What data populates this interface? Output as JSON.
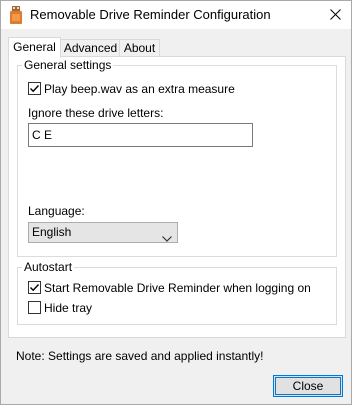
{
  "window": {
    "title": "Removable Drive Reminder Configuration"
  },
  "tabs": [
    {
      "label": "General",
      "active": true
    },
    {
      "label": "Advanced",
      "active": false
    },
    {
      "label": "About",
      "active": false
    }
  ],
  "general_settings": {
    "title": "General settings",
    "play_beep": {
      "label": "Play beep.wav as an extra measure",
      "checked": true
    },
    "ignore_label": "Ignore these drive letters:",
    "ignore_value": "C E",
    "language_label": "Language:",
    "language_value": "English"
  },
  "autostart": {
    "title": "Autostart",
    "start_on_logon": {
      "label": "Start Removable Drive Reminder when logging on",
      "checked": true
    },
    "hide_tray": {
      "label": "Hide tray",
      "checked": false
    }
  },
  "footer": {
    "note": "Note: Settings are saved and applied instantly!",
    "close_label": "Close"
  },
  "colors": {
    "accent": "#0078d7",
    "window_bg": "#f0f0f0"
  }
}
